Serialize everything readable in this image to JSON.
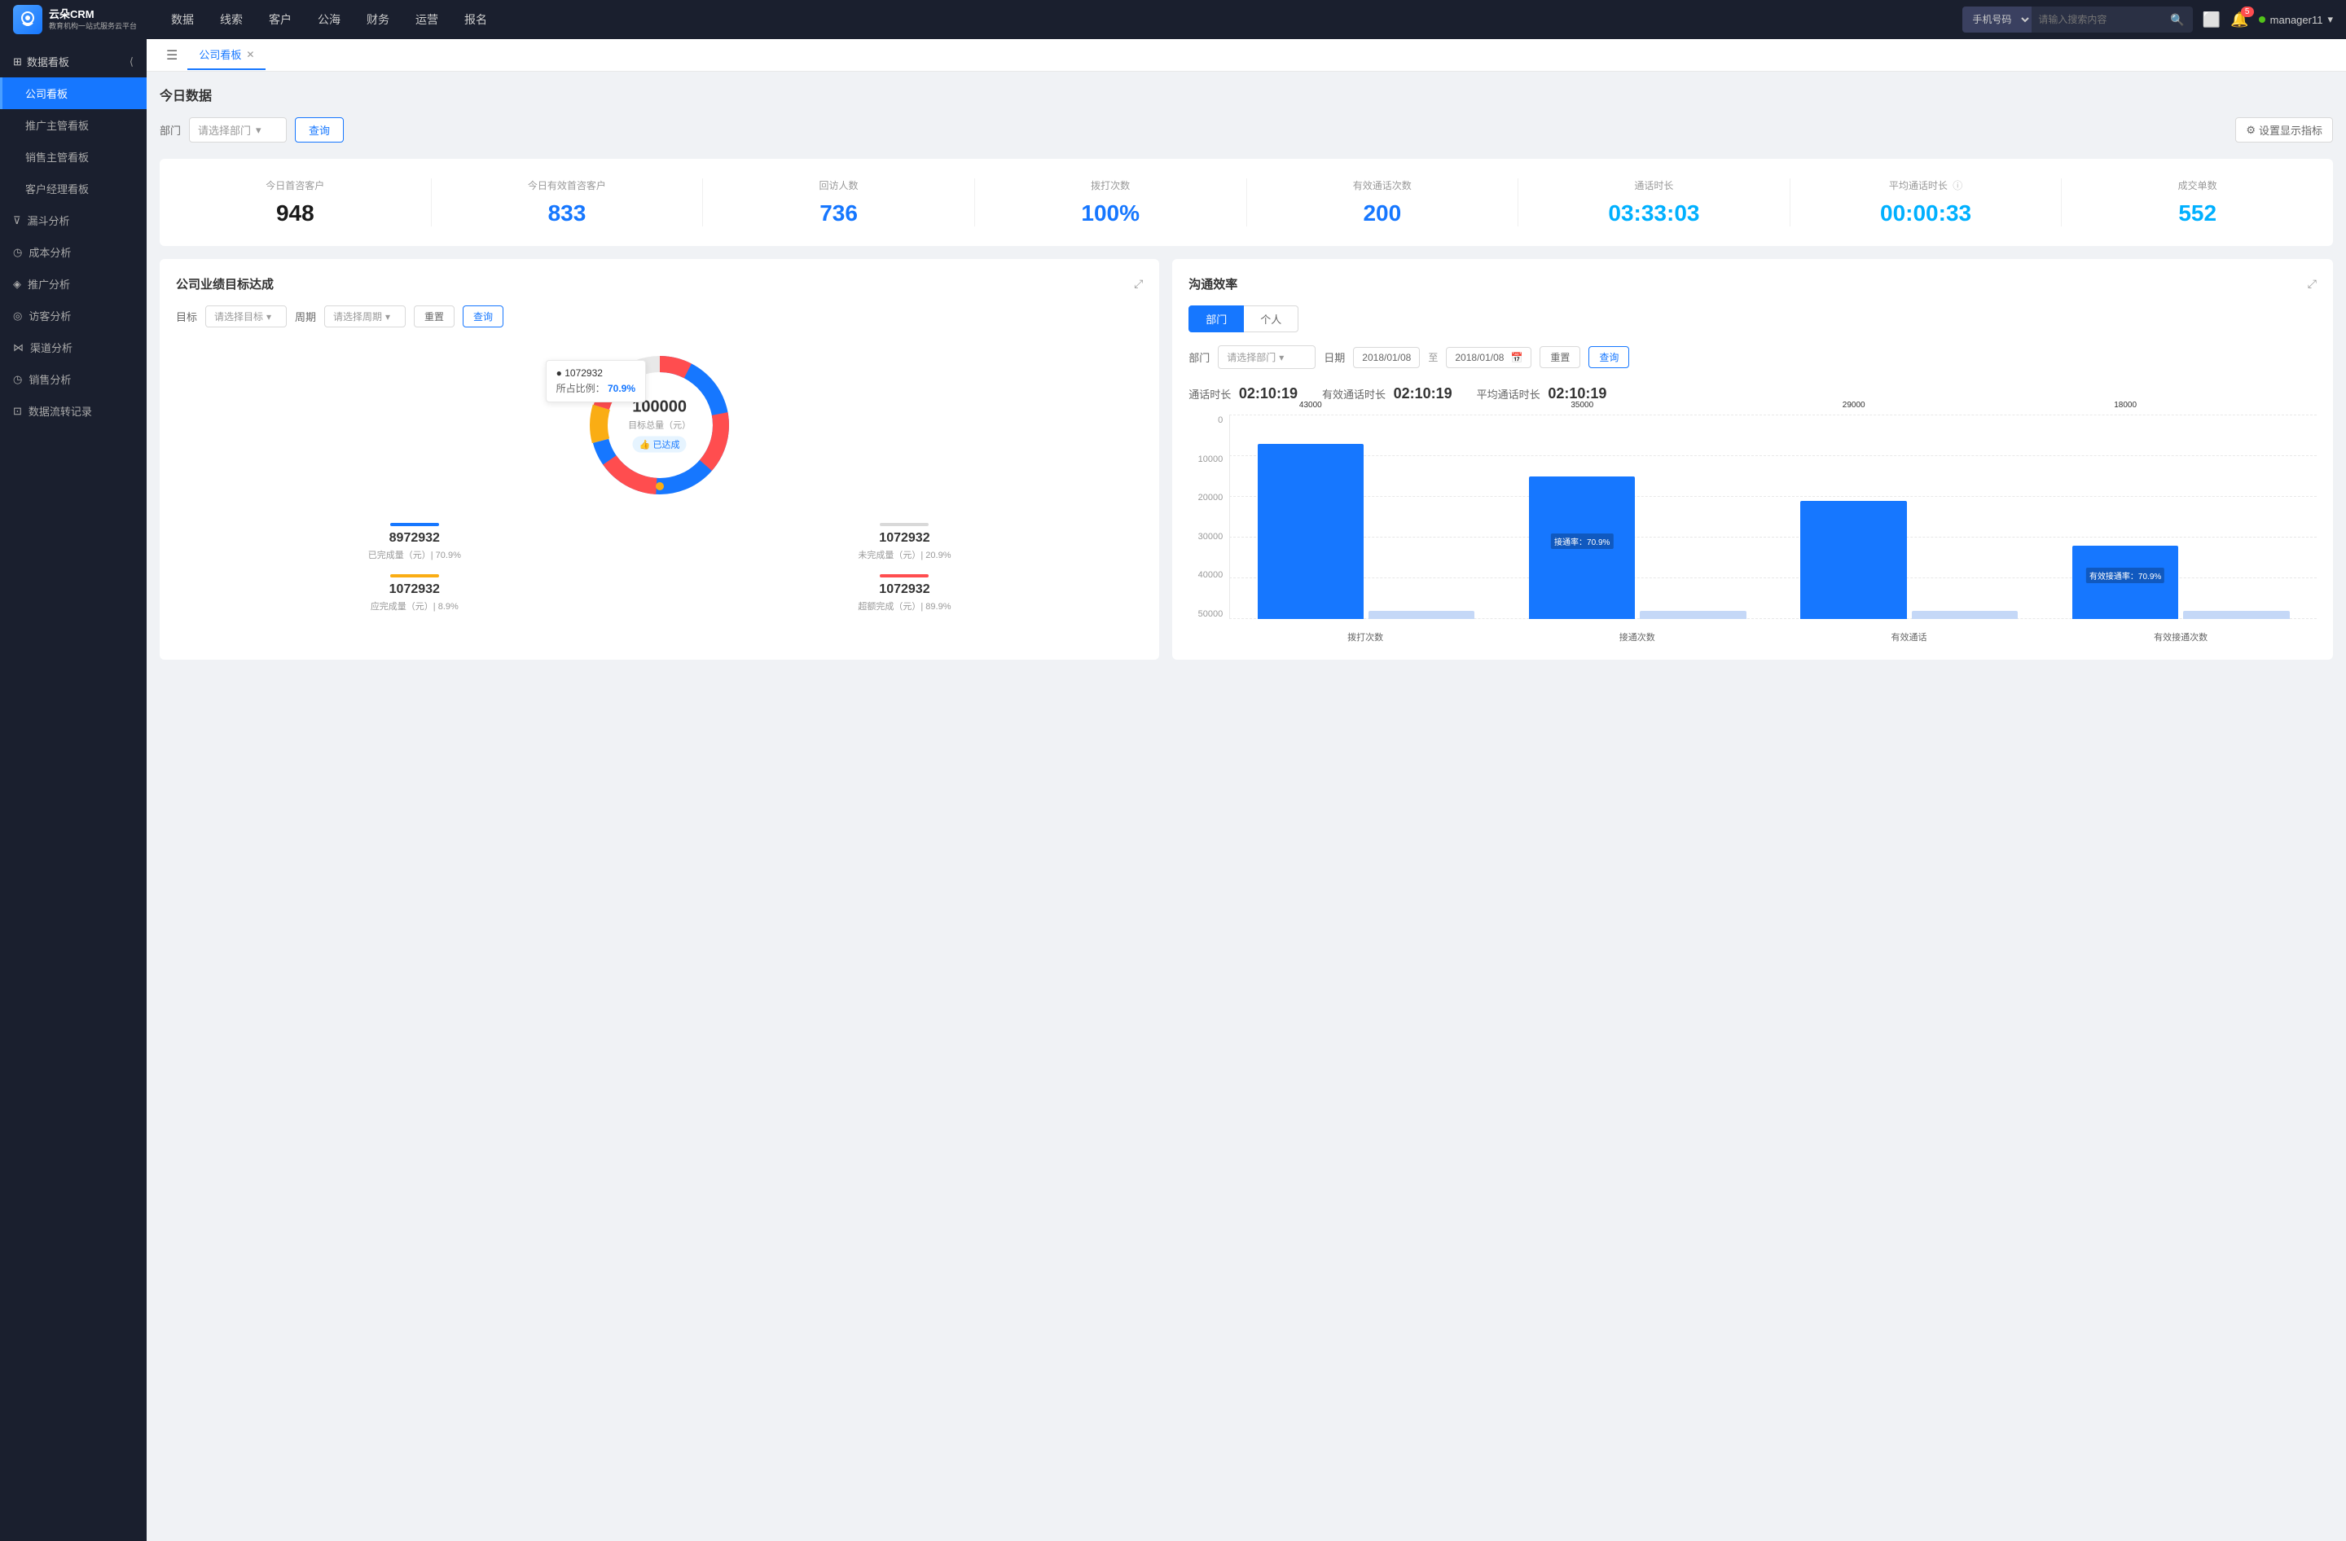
{
  "app": {
    "logo_text_line1": "云朵CRM",
    "logo_text_line2": "教育机构一站式服务云平台"
  },
  "top_nav": {
    "items": [
      "数据",
      "线索",
      "客户",
      "公海",
      "财务",
      "运营",
      "报名"
    ],
    "search_placeholder": "请输入搜索内容",
    "search_select": "手机号码",
    "notification_count": "5",
    "username": "manager11"
  },
  "sidebar": {
    "section_label": "数据看板",
    "items": [
      {
        "label": "公司看板",
        "active": true
      },
      {
        "label": "推广主管看板",
        "active": false
      },
      {
        "label": "销售主管看板",
        "active": false
      },
      {
        "label": "客户经理看板",
        "active": false
      }
    ],
    "analysis_items": [
      {
        "label": "漏斗分析",
        "icon": "funnel"
      },
      {
        "label": "成本分析",
        "icon": "cost"
      },
      {
        "label": "推广分析",
        "icon": "promo"
      },
      {
        "label": "访客分析",
        "icon": "visitor"
      },
      {
        "label": "渠道分析",
        "icon": "channel"
      },
      {
        "label": "销售分析",
        "icon": "sales"
      },
      {
        "label": "数据流转记录",
        "icon": "flow"
      }
    ]
  },
  "tabs": [
    {
      "label": "公司看板",
      "active": true,
      "closable": true
    }
  ],
  "today_data": {
    "title": "今日数据",
    "filter_label": "部门",
    "select_placeholder": "请选择部门",
    "query_btn": "查询",
    "settings_btn": "设置显示指标",
    "stats": [
      {
        "label": "今日首咨客户",
        "value": "948",
        "color": "black"
      },
      {
        "label": "今日有效首咨客户",
        "value": "833",
        "color": "blue"
      },
      {
        "label": "回访人数",
        "value": "736",
        "color": "blue"
      },
      {
        "label": "拨打次数",
        "value": "100%",
        "color": "blue"
      },
      {
        "label": "有效通话次数",
        "value": "200",
        "color": "blue"
      },
      {
        "label": "通话时长",
        "value": "03:33:03",
        "color": "cyan"
      },
      {
        "label": "平均通话时长",
        "value": "00:00:33",
        "color": "cyan"
      },
      {
        "label": "成交单数",
        "value": "552",
        "color": "cyan"
      }
    ]
  },
  "target_panel": {
    "title": "公司业绩目标达成",
    "filter": {
      "target_label": "目标",
      "target_placeholder": "请选择目标",
      "period_label": "周期",
      "period_placeholder": "请选择周期",
      "reset_btn": "重置",
      "query_btn": "查询"
    },
    "donut": {
      "tooltip_value": "1072932",
      "tooltip_percent_label": "所占比例：",
      "tooltip_percent": "70.9%",
      "center_value": "100000",
      "center_label": "目标总量（元）",
      "center_badge": "已达成"
    },
    "legend": [
      {
        "label": "8972932",
        "desc": "已完成量（元）| 70.9%",
        "color": "#1677ff",
        "type": "solid"
      },
      {
        "label": "1072932",
        "desc": "未完成量（元）| 20.9%",
        "color": "#d9d9d9",
        "type": "solid"
      },
      {
        "label": "1072932",
        "desc": "应完成量（元）| 8.9%",
        "color": "#faad14",
        "type": "solid"
      },
      {
        "label": "1072932",
        "desc": "超额完成（元）| 89.9%",
        "color": "#ff4d4f",
        "type": "solid"
      }
    ]
  },
  "efficiency_panel": {
    "title": "沟通效率",
    "tabs": [
      {
        "label": "部门",
        "active": true
      },
      {
        "label": "个人",
        "active": false
      }
    ],
    "filter": {
      "dept_label": "部门",
      "dept_placeholder": "请选择部门",
      "date_label": "日期",
      "date_start": "2018/01/08",
      "date_end": "2018/01/08",
      "reset_btn": "重置",
      "query_btn": "查询"
    },
    "stats": {
      "call_duration_label": "通话时长",
      "call_duration_value": "02:10:19",
      "effective_label": "有效通话时长",
      "effective_value": "02:10:19",
      "avg_label": "平均通话时长",
      "avg_value": "02:10:19"
    },
    "chart": {
      "y_labels": [
        "50000",
        "40000",
        "30000",
        "20000",
        "10000",
        "0"
      ],
      "groups": [
        {
          "x_label": "拨打次数",
          "bars": [
            {
              "value": 43000,
              "label": "43000",
              "color": "#1677ff",
              "height_pct": 86
            },
            {
              "value": 0,
              "label": "",
              "color": "#d9d9d9",
              "height_pct": 5
            }
          ]
        },
        {
          "x_label": "接通次数",
          "annotation": "接通率：70.9%",
          "bars": [
            {
              "value": 35000,
              "label": "35000",
              "color": "#1677ff",
              "height_pct": 70
            },
            {
              "value": 0,
              "label": "",
              "color": "#d9d9d9",
              "height_pct": 4
            }
          ]
        },
        {
          "x_label": "有效通话",
          "bars": [
            {
              "value": 29000,
              "label": "29000",
              "color": "#1677ff",
              "height_pct": 58
            },
            {
              "value": 0,
              "label": "",
              "color": "#d9d9d9",
              "height_pct": 4
            }
          ]
        },
        {
          "x_label": "有效接通次数",
          "annotation": "有效接通率：70.9%",
          "bars": [
            {
              "value": 18000,
              "label": "18000",
              "color": "#1677ff",
              "height_pct": 36
            },
            {
              "value": 0,
              "label": "",
              "color": "#d9d9d9",
              "height_pct": 4
            }
          ]
        }
      ]
    }
  }
}
